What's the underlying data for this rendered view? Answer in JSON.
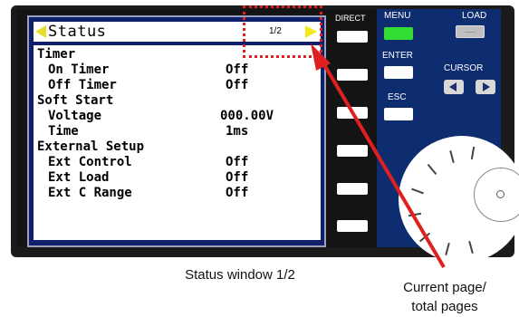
{
  "device": {
    "screen": {
      "title": "Status",
      "page": "1/2",
      "rows": [
        {
          "label": "Timer",
          "value": "",
          "indent": 0
        },
        {
          "label": "On Timer",
          "value": "Off",
          "indent": 1
        },
        {
          "label": "Off Timer",
          "value": "Off",
          "indent": 1
        },
        {
          "label": "Soft Start",
          "value": "",
          "indent": 0
        },
        {
          "label": "Voltage",
          "value": "000.00V",
          "indent": 1
        },
        {
          "label": "Time",
          "value": "1ms",
          "indent": 1
        },
        {
          "label": "External Setup",
          "value": "",
          "indent": 0
        },
        {
          "label": "Ext Control",
          "value": "Off",
          "indent": 1
        },
        {
          "label": "Ext Load",
          "value": "Off",
          "indent": 1
        },
        {
          "label": "Ext C Range",
          "value": "Off",
          "indent": 1
        }
      ]
    },
    "labels": {
      "direct": "DIRECT",
      "menu": "MENU",
      "load": "LOAD",
      "enter": "ENTER",
      "cursor": "CURSOR",
      "esc": "ESC"
    }
  },
  "annotations": {
    "window_caption": "Status window 1/2",
    "page_caption_line1": "Current page/",
    "page_caption_line2": "total pages"
  },
  "colors": {
    "lcd_background": "#0f1f6a",
    "menu_button": "#33dd33",
    "highlight": "#e02020",
    "header_arrow": "#f4ea18"
  }
}
